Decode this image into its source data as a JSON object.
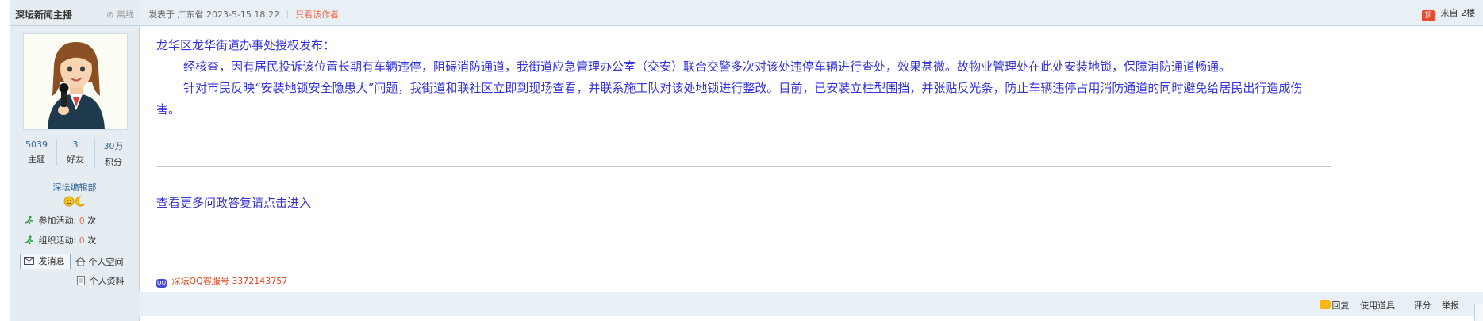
{
  "author": {
    "name": "深坛新闻主播",
    "status": "离线",
    "stats": [
      {
        "value": "5039",
        "label": "主题"
      },
      {
        "value": "3",
        "label": "好友"
      },
      {
        "value": "30万",
        "label": "积分"
      }
    ],
    "group": "深坛编辑部",
    "activities": [
      {
        "label": "参加活动:",
        "count": "0",
        "unit": "次"
      },
      {
        "label": "组织活动:",
        "count": "0",
        "unit": "次"
      }
    ],
    "send_message": "发消息",
    "personal_space": "个人空间",
    "personal_profile": "个人资料"
  },
  "post": {
    "posted_at": "发表于 广东省 2023-5-15 18:22",
    "only_author": "只看该作者",
    "app_badge": "顶",
    "floor": "来自 2楼",
    "lines": [
      "龙华区龙华街道办事处授权发布：",
      "经核查，因有居民投诉该位置长期有车辆违停，阻碍消防通道，我街道应急管理办公室（交安）联合交警多次对该处违停车辆进行查处，效果甚微。故物业管理处在此处安装地锁，保障消防通道畅通。",
      "针对市民反映“安装地锁安全隐患大”问题，我街道和联社区立即到现场查看，并联系施工队对该处地锁进行整改。目前，已安装立柱型围挡，并张贴反光条，防止车辆违停占用消防通道的同时避免给居民出行造成伤害。"
    ],
    "more_link": "查看更多问政答复请点击进入",
    "qq_badge": "QQ",
    "qq_service": "深坛QQ客服号 3372143757"
  },
  "footer": {
    "reply": "回复",
    "use_tool": "使用道具",
    "rate": "评分",
    "report": "举报"
  },
  "colors": {
    "accent_link": "#336699",
    "highlight": "#f26c4f",
    "body_text": "#3333dd",
    "header_bg": "#e8eff5",
    "sidebar_bg": "#e5edf2"
  }
}
